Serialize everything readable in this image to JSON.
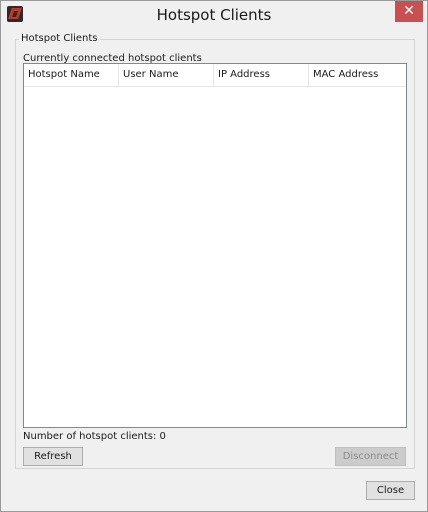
{
  "window": {
    "title": "Hotspot Clients",
    "close_glyph": "✕"
  },
  "group": {
    "legend": "Hotspot Clients",
    "caption": "Currently connected hotspot clients"
  },
  "table": {
    "columns": [
      "Hotspot Name",
      "User Name",
      "IP Address",
      "MAC Address"
    ],
    "rows": []
  },
  "status": {
    "client_count_text": "Number of hotspot clients: 0"
  },
  "buttons": {
    "refresh": "Refresh",
    "disconnect": "Disconnect",
    "close": "Close"
  },
  "colors": {
    "close_button": "#c75050",
    "window_bg": "#f0f0f0",
    "table_bg": "#ffffff"
  },
  "icons": {
    "app": "watchguard-app-icon",
    "close": "close-icon"
  }
}
